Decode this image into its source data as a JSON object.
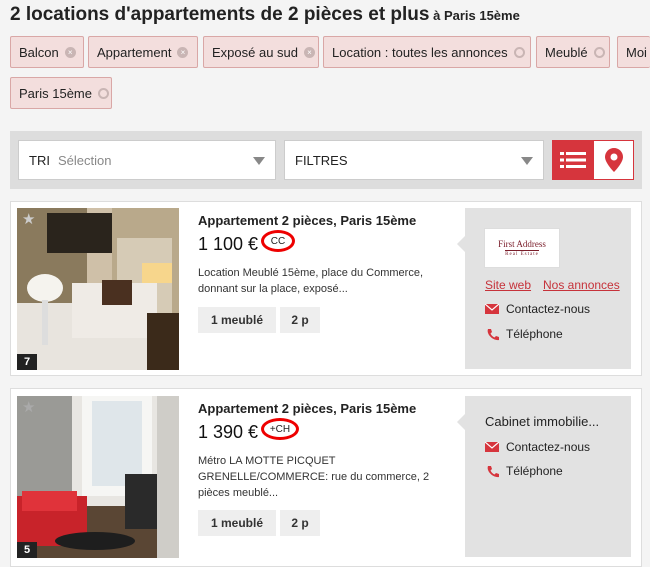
{
  "header": {
    "title": "2  locations d'appartements de 2 pièces et plus",
    "subtitle": " à Paris 15ème"
  },
  "filters": [
    {
      "label": "Balcon",
      "icon": "remove-icon"
    },
    {
      "label": "Appartement",
      "icon": "remove-icon"
    },
    {
      "label": "Exposé au sud",
      "icon": "remove-icon"
    },
    {
      "label": "Location : toutes les annonces",
      "icon": "reset-icon"
    },
    {
      "label": "Meublé",
      "icon": "reset-icon"
    },
    {
      "label": "Moi",
      "icon": "reset-icon"
    },
    {
      "label": "Paris 15ème",
      "icon": "reset-icon"
    }
  ],
  "toolbar": {
    "sort_label": "TRI",
    "sort_placeholder": "Sélection",
    "filters_label": "FILTRES"
  },
  "colors": {
    "accent": "#d6353d",
    "chip_bg": "#f3dedd",
    "side_bg": "#e2e2e2"
  },
  "listings": [
    {
      "title": "Appartement 2 pièces, Paris 15ème",
      "price": "1 100 €",
      "price_suffix": "CC",
      "description": "Location Meublé 15ème, place du Commerce, donnant sur la place, exposé...",
      "tags": [
        "1 meublé",
        "2 p"
      ],
      "photo_count": "7",
      "agency": {
        "logo_line1": "First Address",
        "logo_line2": "Real Estate",
        "site_link": "Site web",
        "ads_link": "Nos annonces",
        "contact": "Contactez-nous",
        "phone": "Téléphone"
      }
    },
    {
      "title": "Appartement 2 pièces, Paris 15ème",
      "price": "1 390 €",
      "price_suffix": "+CH",
      "description": "Métro LA MOTTE PICQUET GRENELLE/COMMERCE: rue du commerce, 2 pièces meublé...",
      "tags": [
        "1 meublé",
        "2 p"
      ],
      "photo_count": "5",
      "agency": {
        "name": "Cabinet immobilie...",
        "contact": "Contactez-nous",
        "phone": "Téléphone"
      }
    }
  ]
}
